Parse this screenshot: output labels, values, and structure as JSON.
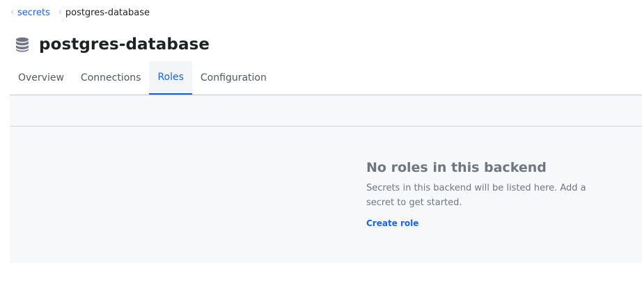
{
  "breadcrumb": {
    "parent_label": "secrets",
    "current_label": "postgres-database"
  },
  "header": {
    "title": "postgres-database",
    "icon": "database-icon"
  },
  "tabs": [
    {
      "label": "Overview",
      "active": false
    },
    {
      "label": "Connections",
      "active": false
    },
    {
      "label": "Roles",
      "active": true
    },
    {
      "label": "Configuration",
      "active": false
    }
  ],
  "empty_state": {
    "title": "No roles in this backend",
    "message": "Secrets in this backend will be listed here. Add a secret to get started.",
    "action_label": "Create role"
  },
  "colors": {
    "accent": "#1563ff",
    "muted_text": "#6f7682",
    "panel_bg": "#f7f8fa"
  }
}
